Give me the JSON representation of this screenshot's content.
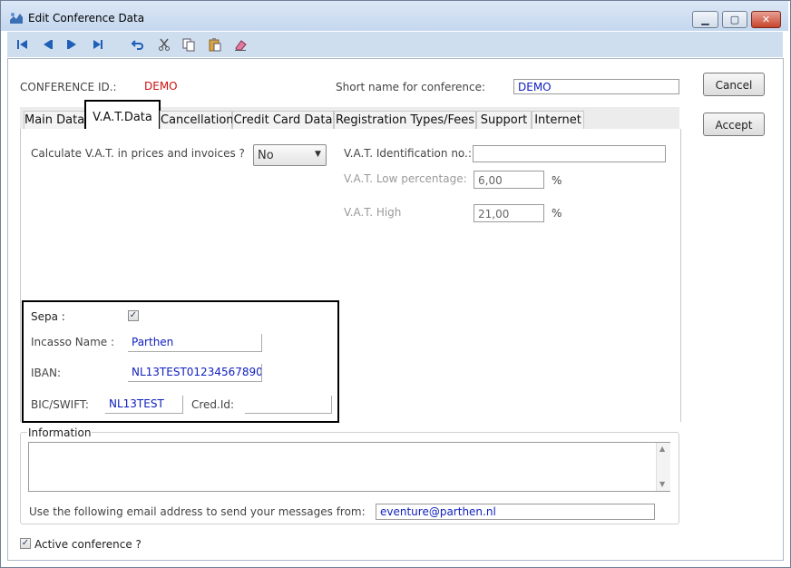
{
  "window": {
    "title": "Edit Conference Data"
  },
  "toolbar": {
    "icons": [
      "first-record-icon",
      "previous-record-icon",
      "next-record-icon",
      "last-record-icon",
      "undo-icon",
      "cut-icon",
      "copy-icon",
      "paste-icon",
      "clear-icon"
    ]
  },
  "header": {
    "conference_id_label": "CONFERENCE ID.:",
    "conference_id_value": "DEMO",
    "short_name_label": "Short name for conference:",
    "short_name_value": "DEMO"
  },
  "buttons": {
    "cancel": "Cancel",
    "accept": "Accept"
  },
  "tabs": [
    {
      "label": "Main Data"
    },
    {
      "label": "V.A.T.Data"
    },
    {
      "label": "Cancellation"
    },
    {
      "label": "Credit Card Data"
    },
    {
      "label": "Registration Types/Fees"
    },
    {
      "label": "Support"
    },
    {
      "label": "Internet"
    }
  ],
  "vat": {
    "calc_label": "Calculate V.A.T. in prices and invoices ?",
    "calc_value": "No",
    "id_label": "V.A.T. Identification no.:",
    "id_value": "",
    "low_label": "V.A.T. Low percentage:",
    "low_value": "6,00",
    "high_label": "V.A.T. High",
    "high_value": "21,00",
    "percent": "%"
  },
  "sepa": {
    "sepa_label": "Sepa :",
    "sepa_checked": true,
    "incasso_label": "Incasso Name :",
    "incasso_value": "Parthen",
    "iban_label": "IBAN:",
    "iban_value": "NL13TEST01234567890",
    "bic_label": "BIC/SWIFT:",
    "bic_value": "NL13TEST",
    "cred_label": "Cred.Id:",
    "cred_value": ""
  },
  "information": {
    "label": "Information",
    "text": "",
    "email_label": "Use the following email address to send your messages from:",
    "email_value": "eventure@parthen.nl"
  },
  "footer": {
    "active_label": "Active conference ?",
    "active_checked": true
  },
  "colors": {
    "accent_red": "#d01010",
    "value_blue": "#1020c0",
    "titlebar": "#c5d7ee"
  }
}
